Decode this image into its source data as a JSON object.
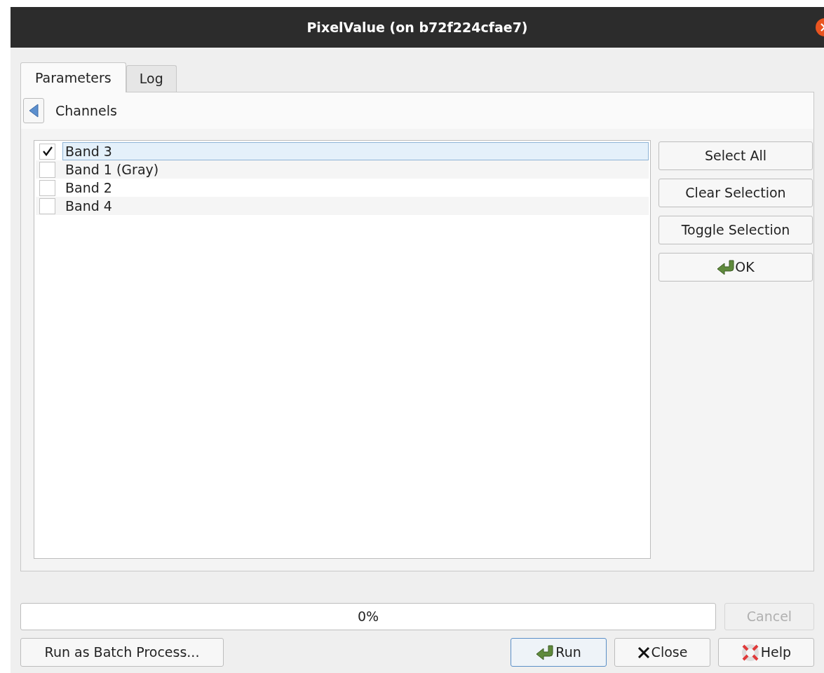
{
  "window": {
    "title": "PixelValue (on b72f224cfae7)"
  },
  "tabs": [
    {
      "label": "Parameters",
      "selected": true
    },
    {
      "label": "Log",
      "selected": false
    }
  ],
  "panel": {
    "title": "Channels"
  },
  "channels": [
    {
      "label": "Band 3",
      "checked": true,
      "selected": true
    },
    {
      "label": "Band 1 (Gray)",
      "checked": false,
      "selected": false
    },
    {
      "label": "Band 2",
      "checked": false,
      "selected": false
    },
    {
      "label": "Band 4",
      "checked": false,
      "selected": false
    }
  ],
  "side_buttons": [
    {
      "label": "Select All",
      "kind": "plain"
    },
    {
      "label": "Clear Selection",
      "kind": "plain"
    },
    {
      "label": "Toggle Selection",
      "kind": "plain"
    },
    {
      "label": "OK",
      "kind": "arrow"
    }
  ],
  "progress": {
    "level": 0,
    "reading": "0%"
  },
  "cancel": {
    "label": "Cancel",
    "disabled": true
  },
  "batch_button": {
    "label": "Run as Batch Process..."
  },
  "buttons": [
    {
      "label": "Run",
      "kind": "arrow",
      "default": true
    },
    {
      "label": "Close",
      "kind": "cross",
      "default": false
    },
    {
      "label": "Help",
      "kind": "help",
      "default": false
    }
  ]
}
